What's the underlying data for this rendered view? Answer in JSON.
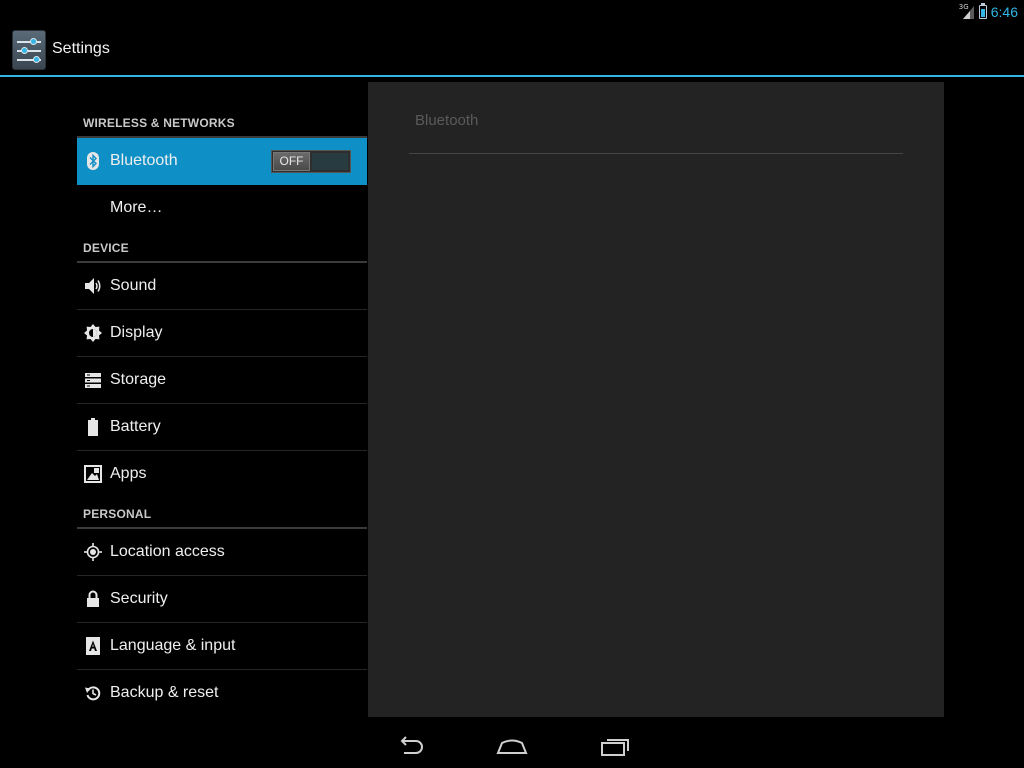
{
  "status_bar": {
    "network_type": "3G",
    "time": "6:46"
  },
  "action_bar": {
    "title": "Settings",
    "icon": "settings-sliders-icon"
  },
  "sections": {
    "wireless": {
      "header": "WIRELESS & NETWORKS",
      "bluetooth": {
        "label": "Bluetooth",
        "icon": "bluetooth-icon",
        "toggle": "OFF"
      },
      "more": {
        "label": "More…"
      }
    },
    "device": {
      "header": "DEVICE",
      "sound": {
        "label": "Sound",
        "icon": "speaker-icon"
      },
      "display": {
        "label": "Display",
        "icon": "brightness-icon"
      },
      "storage": {
        "label": "Storage",
        "icon": "storage-icon"
      },
      "battery": {
        "label": "Battery",
        "icon": "battery-icon"
      },
      "apps": {
        "label": "Apps",
        "icon": "apps-icon"
      }
    },
    "personal": {
      "header": "PERSONAL",
      "location": {
        "label": "Location access",
        "icon": "location-icon"
      },
      "security": {
        "label": "Security",
        "icon": "lock-icon"
      },
      "language": {
        "label": "Language & input",
        "icon": "language-icon"
      },
      "backup": {
        "label": "Backup & reset",
        "icon": "backup-icon"
      }
    }
  },
  "detail": {
    "title": "Bluetooth"
  },
  "colors": {
    "accent": "#33b5e5",
    "selected": "#0e8fc5",
    "pane": "#232323"
  }
}
